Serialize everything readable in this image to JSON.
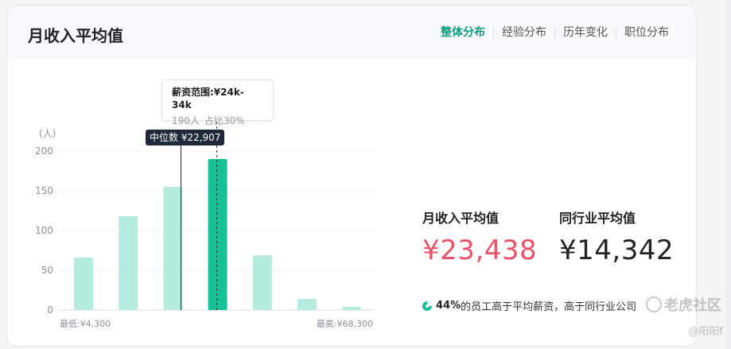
{
  "card": {
    "title": "月收入平均值",
    "tabs": [
      {
        "label": "整体分布",
        "active": true
      },
      {
        "label": "经验分布",
        "active": false
      },
      {
        "label": "历年变化",
        "active": false
      },
      {
        "label": "职位分布",
        "active": false
      }
    ]
  },
  "chart_data": {
    "type": "bar",
    "ylabel": "(人)",
    "ylim": [
      0,
      200
    ],
    "yticks": [
      0,
      50,
      100,
      150,
      200
    ],
    "values": [
      66,
      118,
      155,
      190,
      69,
      14,
      4
    ],
    "highlight_index": 3,
    "colors": {
      "bar": "#b6ebe0",
      "highlight": "#18c096",
      "grid": "#eef0f3"
    },
    "x_min_label": "最低:¥4,300",
    "x_max_label": "最高:¥68,300",
    "median_label": "中位数 ¥22,907",
    "tooltip": {
      "title": "薪资范围:¥24k-34k",
      "count": "190人",
      "share": "占比30%"
    }
  },
  "stats": {
    "avg_label": "月收入平均值",
    "avg_value": "¥23,438",
    "industry_label": "同行业平均值",
    "industry_value": "¥14,342"
  },
  "note": {
    "percent": "44%",
    "text": "的员工高于平均薪资，高于同行业公司"
  },
  "watermark": {
    "brand": "老虎社区",
    "user": "@阳阳f"
  }
}
